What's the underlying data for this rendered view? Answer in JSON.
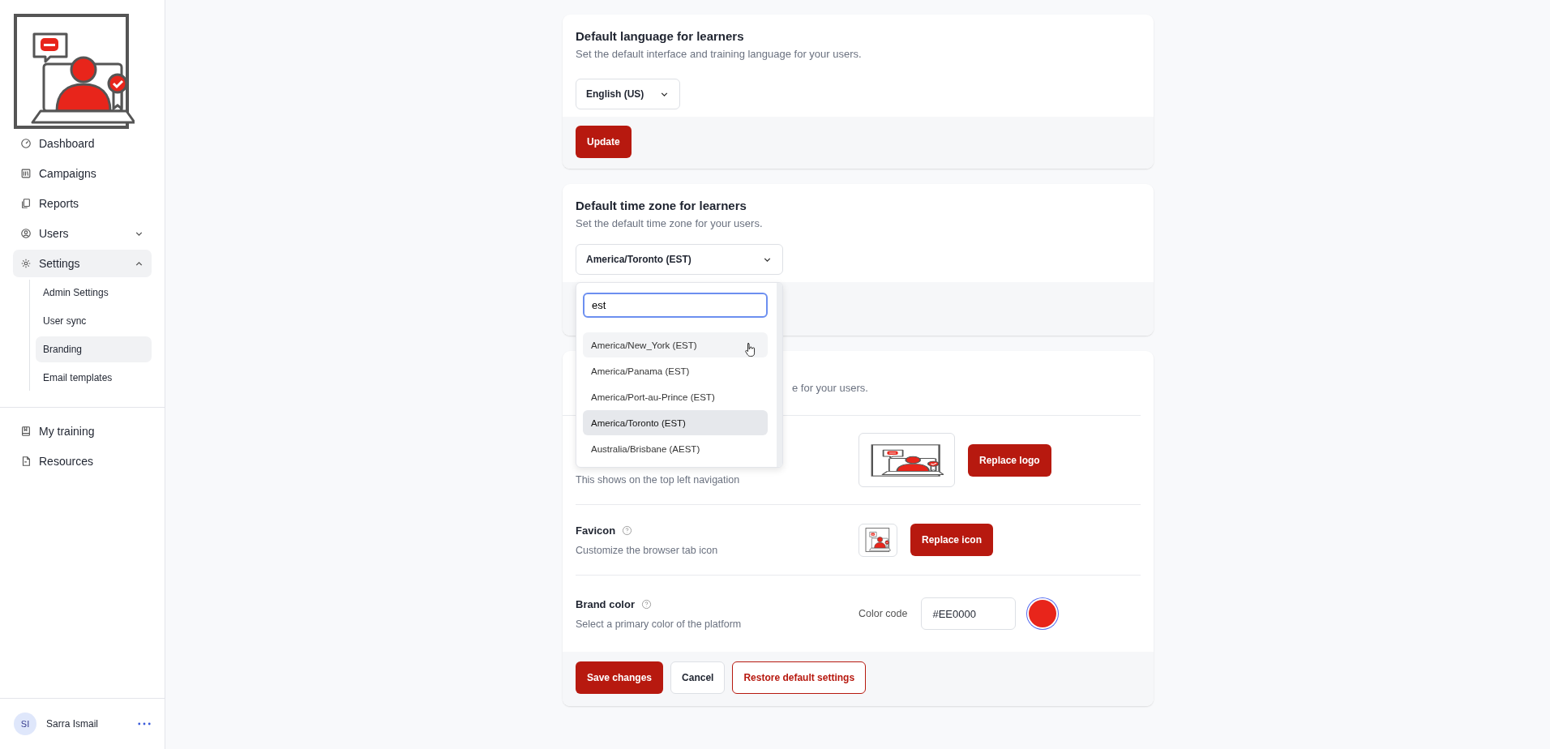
{
  "sidebar": {
    "nav": [
      {
        "label": "Dashboard",
        "selected": false
      },
      {
        "label": "Campaigns",
        "selected": false
      },
      {
        "label": "Reports",
        "selected": false
      },
      {
        "label": "Users",
        "selected": false,
        "expanded": false
      },
      {
        "label": "Settings",
        "selected": true,
        "expanded": true,
        "children": [
          {
            "label": "Admin Settings",
            "selected": false
          },
          {
            "label": "User sync",
            "selected": false
          },
          {
            "label": "Branding",
            "selected": true
          },
          {
            "label": "Email templates",
            "selected": false
          }
        ]
      }
    ],
    "secondary_nav": [
      {
        "label": "My training",
        "selected": false
      },
      {
        "label": "Resources",
        "selected": false
      }
    ],
    "user": {
      "initials": "SI",
      "name": "Sarra Ismail"
    }
  },
  "language_card": {
    "title": "Default language for learners",
    "description": "Set the default interface and training language for your users.",
    "select": {
      "value": "English (US)"
    },
    "button": "Update"
  },
  "timezone_card": {
    "title": "Default time zone for learners",
    "description": "Set the default time zone for your users.",
    "select": {
      "value": "America/Toronto (EST)",
      "expanded": true
    },
    "dropdown": {
      "search": {
        "value": "est"
      },
      "options": [
        {
          "label": "America/New_York (EST)",
          "hovered": true,
          "selected": false
        },
        {
          "label": "America/Panama (EST)",
          "hovered": false,
          "selected": false
        },
        {
          "label": "America/Port-au-Prince (EST)",
          "hovered": false,
          "selected": false
        },
        {
          "label": "America/Toronto (EST)",
          "hovered": false,
          "selected": true
        },
        {
          "label": "Australia/Brisbane (AEST)",
          "hovered": false,
          "selected": false
        }
      ]
    }
  },
  "branding_card": {
    "description_fragment": "e for your users.",
    "rows": [
      {
        "kind": "logo",
        "description": "This shows on the top left navigation",
        "button": "Replace logo"
      },
      {
        "kind": "favicon",
        "title": "Favicon",
        "description": "Customize the browser tab icon",
        "button": "Replace icon"
      },
      {
        "kind": "color",
        "title": "Brand color",
        "description": "Select a primary color of the platform",
        "label": "Color code",
        "value": "#EE0000",
        "color": "#e8251b"
      }
    ],
    "buttons": [
      {
        "label": "Save changes",
        "kind": "primary"
      },
      {
        "label": "Cancel",
        "kind": "secondary"
      },
      {
        "label": "Restore default settings",
        "kind": "outline"
      }
    ]
  }
}
